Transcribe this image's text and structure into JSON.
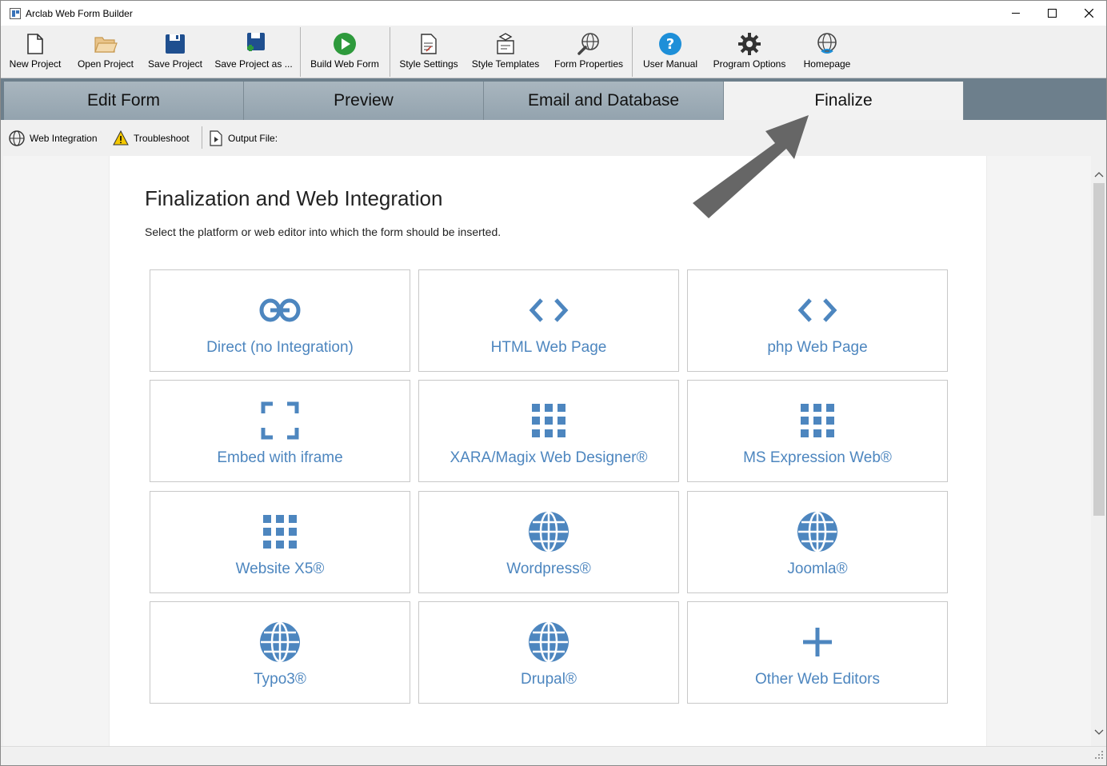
{
  "window": {
    "title": "Arclab Web Form Builder",
    "controls": [
      "minimize",
      "maximize",
      "close"
    ]
  },
  "toolbar": {
    "items": [
      {
        "label": "New Project",
        "icon": "new-document-icon"
      },
      {
        "label": "Open Project",
        "icon": "folder-open-icon"
      },
      {
        "label": "Save Project",
        "icon": "floppy-disk-icon"
      },
      {
        "label": "Save Project as ...",
        "icon": "floppy-disk-plus-icon"
      },
      {
        "label": "Build Web Form",
        "icon": "play-icon"
      },
      {
        "label": "Style Settings",
        "icon": "style-document-icon"
      },
      {
        "label": "Style Templates",
        "icon": "template-icon"
      },
      {
        "label": "Form Properties",
        "icon": "globe-wrench-icon"
      },
      {
        "label": "User Manual",
        "icon": "help-icon"
      },
      {
        "label": "Program Options",
        "icon": "gear-icon"
      },
      {
        "label": "Homepage",
        "icon": "globe-link-icon"
      }
    ]
  },
  "tabs": [
    {
      "label": "Edit Form",
      "active": false
    },
    {
      "label": "Preview",
      "active": false
    },
    {
      "label": "Email and Database",
      "active": false
    },
    {
      "label": "Finalize",
      "active": true
    }
  ],
  "subtoolbar": {
    "web_integration": "Web Integration",
    "troubleshoot": "Troubleshoot",
    "output_file": "Output File:"
  },
  "main": {
    "title": "Finalization and Web Integration",
    "subtitle": "Select the platform or web editor into which the form should be inserted.",
    "cards": [
      {
        "label": "Direct (no Integration)",
        "icon": "link-icon"
      },
      {
        "label": "HTML Web Page",
        "icon": "code-icon"
      },
      {
        "label": "php Web Page",
        "icon": "code-icon"
      },
      {
        "label": "Embed with iframe",
        "icon": "frame-corners-icon"
      },
      {
        "label": "XARA/Magix Web Designer®",
        "icon": "grid-icon"
      },
      {
        "label": "MS Expression Web®",
        "icon": "grid-icon"
      },
      {
        "label": "Website X5®",
        "icon": "grid-icon"
      },
      {
        "label": "Wordpress®",
        "icon": "globe-icon"
      },
      {
        "label": "Joomla®",
        "icon": "globe-icon"
      },
      {
        "label": "Typo3®",
        "icon": "globe-icon"
      },
      {
        "label": "Drupal®",
        "icon": "globe-icon"
      },
      {
        "label": "Other Web Editors",
        "icon": "plus-icon"
      }
    ]
  },
  "colors": {
    "accent": "#4d86bf",
    "tab_bar": "#6d7f8c",
    "tab_inactive": "#9fadb7"
  }
}
